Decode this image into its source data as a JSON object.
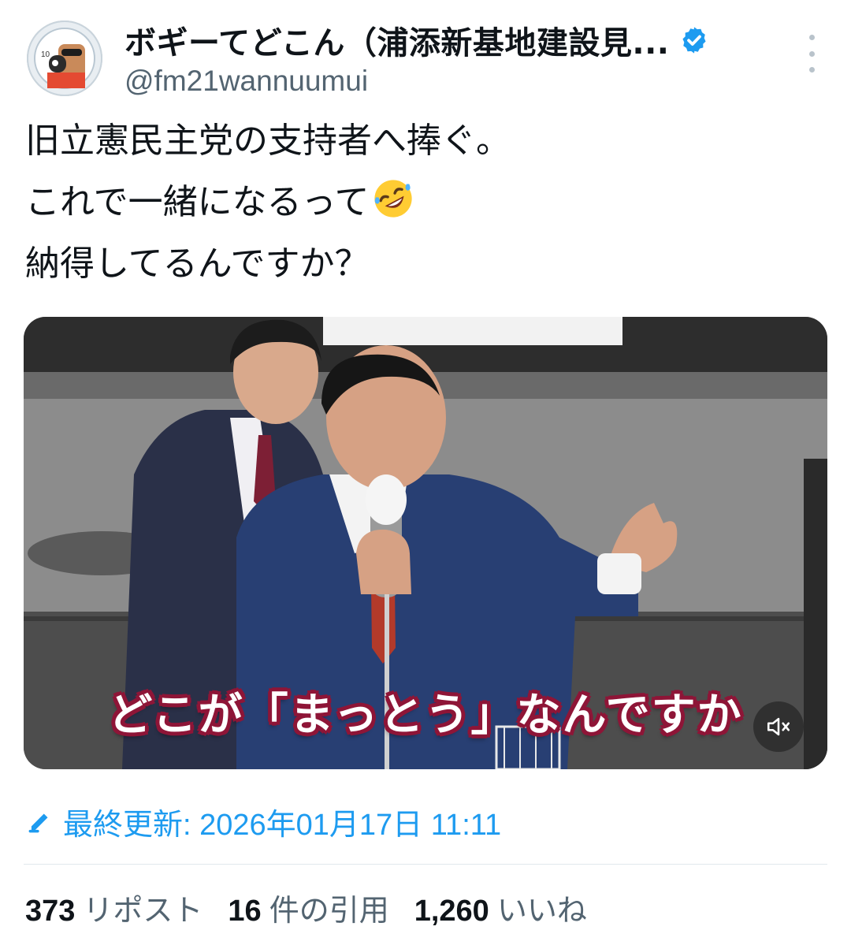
{
  "author": {
    "display_name": "ボギーてどこん（浦添新基地建設見...",
    "handle": "@fm21wannuumui",
    "avatar_icon": "user-avatar-icon",
    "verified_icon": "verified-badge-icon",
    "verified_color": "#1d9bf0"
  },
  "tweet": {
    "lines": [
      "旧立憲民主党の支持者へ捧ぐ。",
      "これで一緒になるって",
      "納得してるんですか？"
    ],
    "emoji": "rolling-on-the-floor-laughing-emoji"
  },
  "media": {
    "caption": "どこが「まっとう」なんですか",
    "mute_icon": "speaker-muted-icon"
  },
  "updated": {
    "icon": "pencil-icon",
    "text": "最終更新: 2026年01月17日 11:11"
  },
  "stats": {
    "reposts_count": "373",
    "reposts_label": "リポスト",
    "quotes_count": "16",
    "quotes_label": "件の引用",
    "likes_count": "1,260",
    "likes_label": "いいね"
  },
  "colors": {
    "accent": "#1d9bf0",
    "text": "#0f1419",
    "muted": "#536471",
    "caption_outline": "#8e1537"
  }
}
